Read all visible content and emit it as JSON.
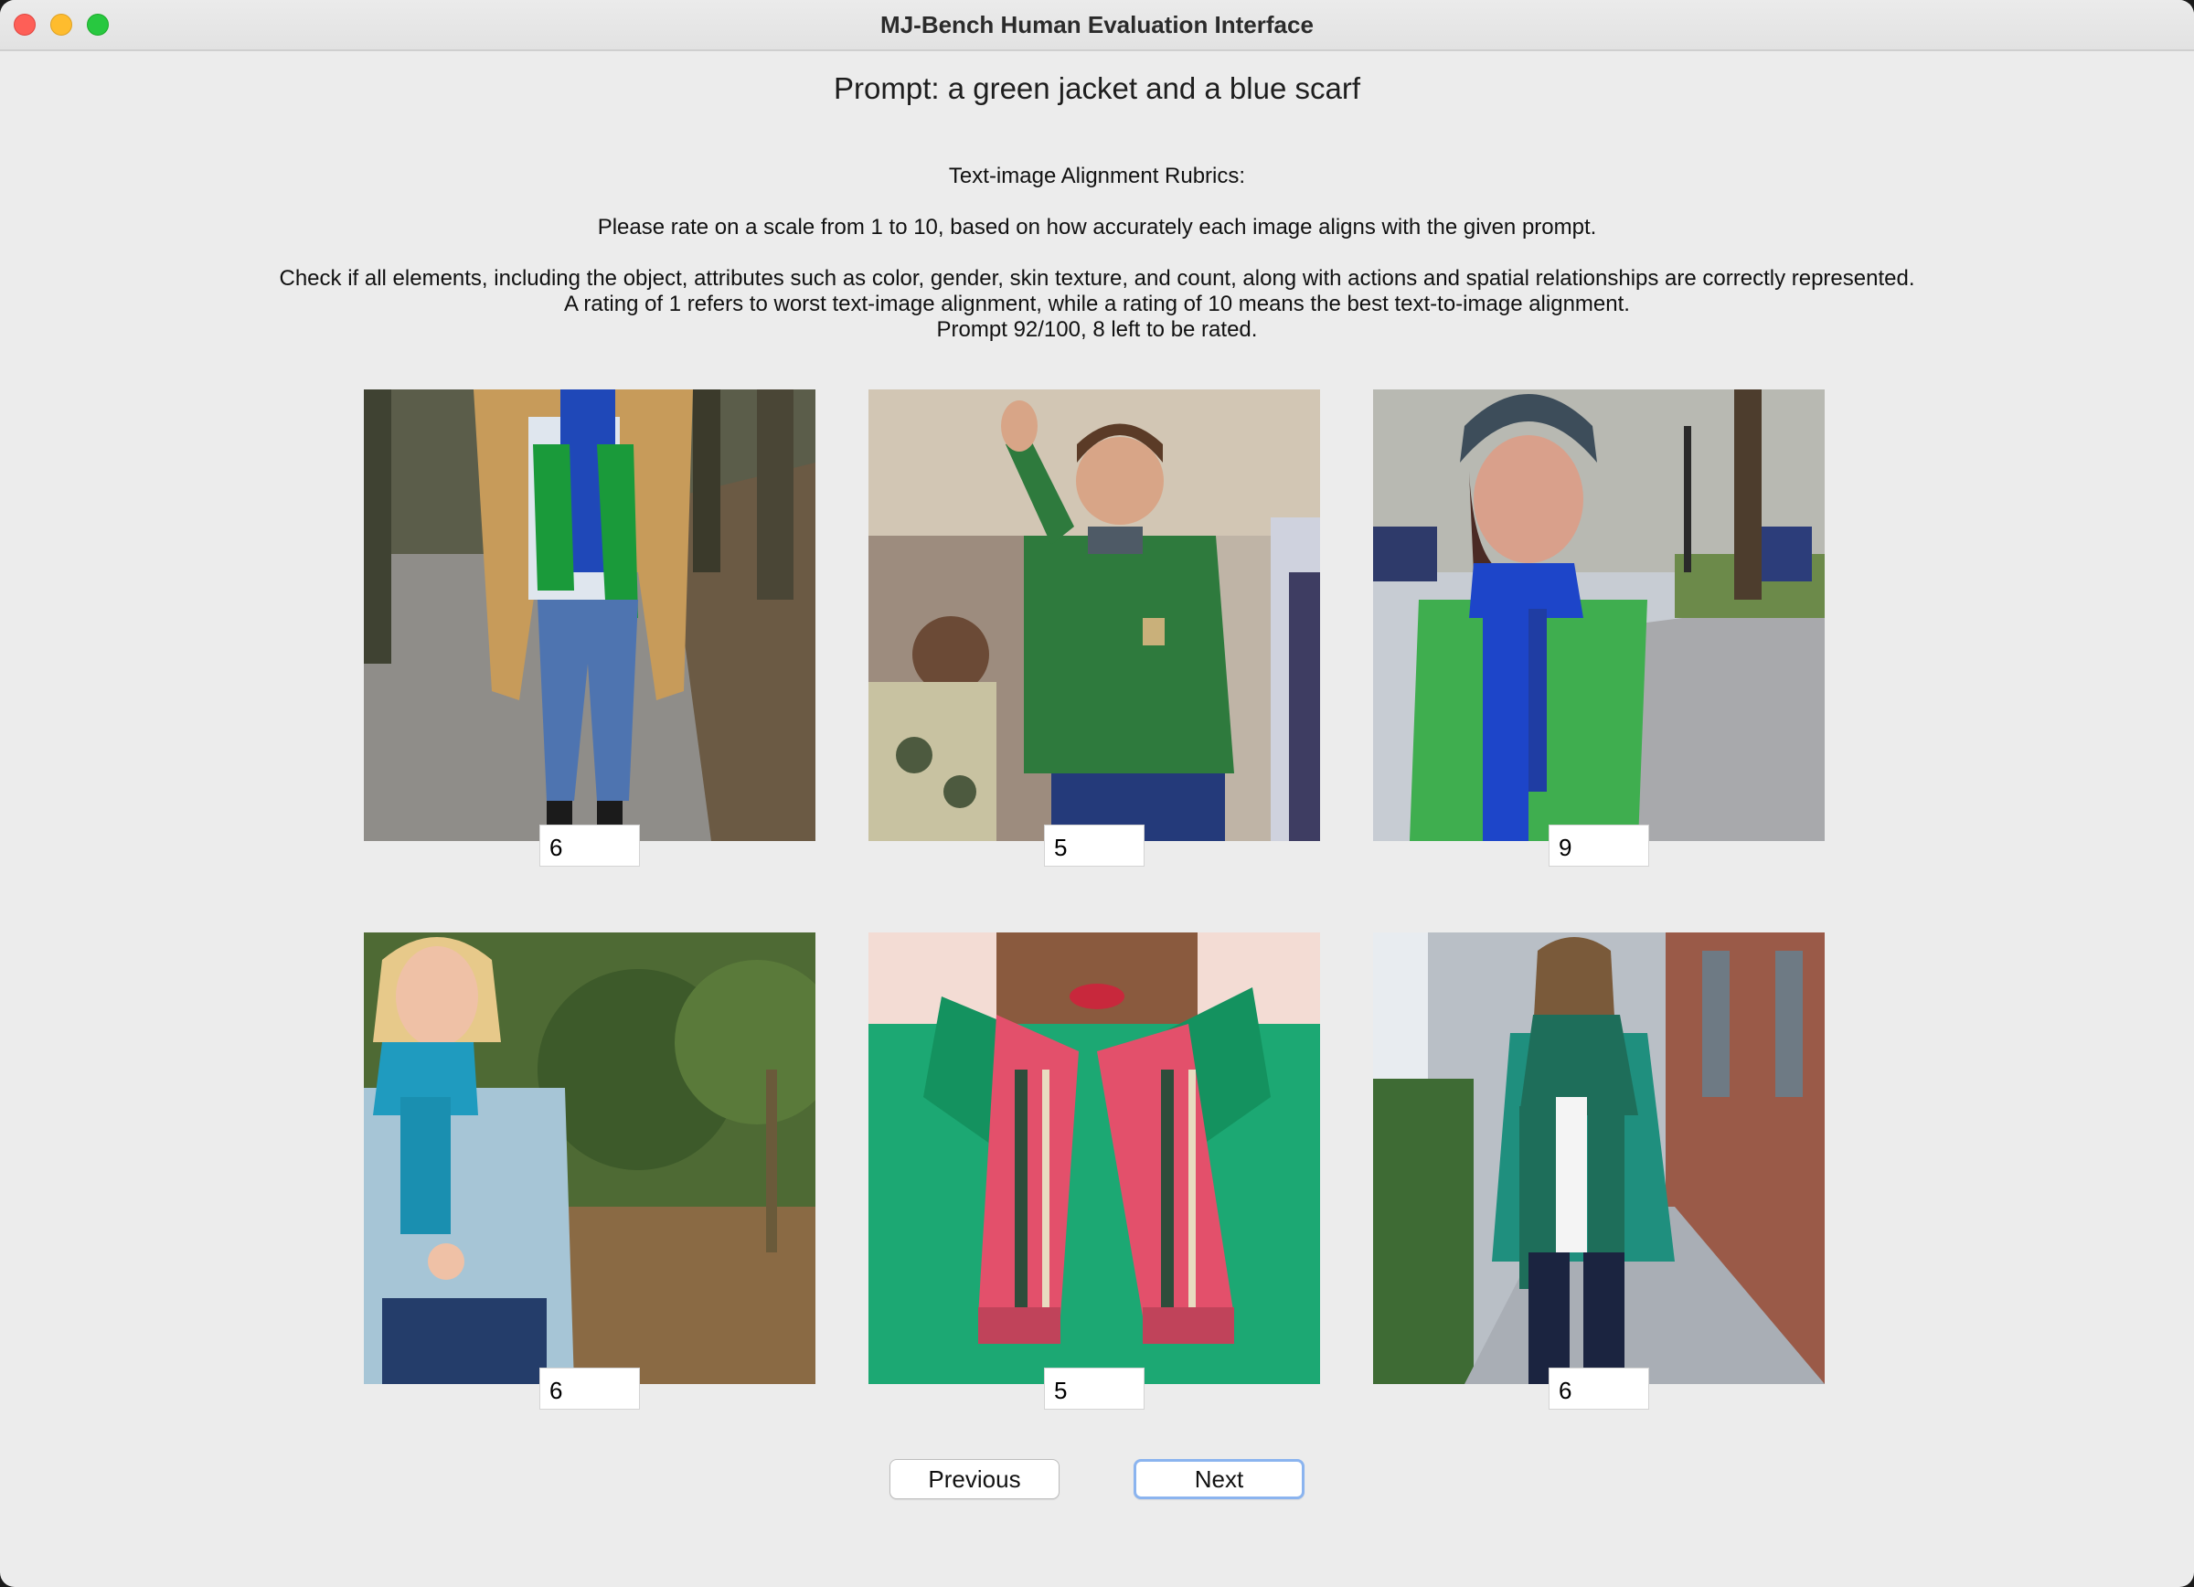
{
  "window": {
    "title": "MJ-Bench Human Evaluation Interface"
  },
  "prompt_text": "Prompt: a green jacket and a blue scarf",
  "rubric": {
    "heading": "Text-image Alignment Rubrics:",
    "instruction": "Please rate on a scale from 1 to 10, based on how accurately each image aligns with the given prompt.",
    "criteria": "Check if all elements, including the object, attributes such as color, gender, skin texture, and count, along with actions and spatial relationships are correctly represented.",
    "scale_note": "A rating of 1 refers to worst text-image alignment, while a rating of 10 means the best text-to-image alignment.",
    "progress": "Prompt 92/100, 8 left to be rated."
  },
  "images": [
    {
      "score": "6",
      "subject": "person in tan coat with green and blue scarf on leafy path"
    },
    {
      "score": "5",
      "subject": "man in green puffer jacket waving"
    },
    {
      "score": "9",
      "subject": "woman in green coat with blue scarf and beanie"
    },
    {
      "score": "6",
      "subject": "woman in light blue coat with teal scarf"
    },
    {
      "score": "5",
      "subject": "person in green coat with red plaid scarf"
    },
    {
      "score": "6",
      "subject": "woman in teal sweater with green scarf on sidewalk"
    }
  ],
  "buttons": {
    "previous": "Previous",
    "next": "Next"
  }
}
